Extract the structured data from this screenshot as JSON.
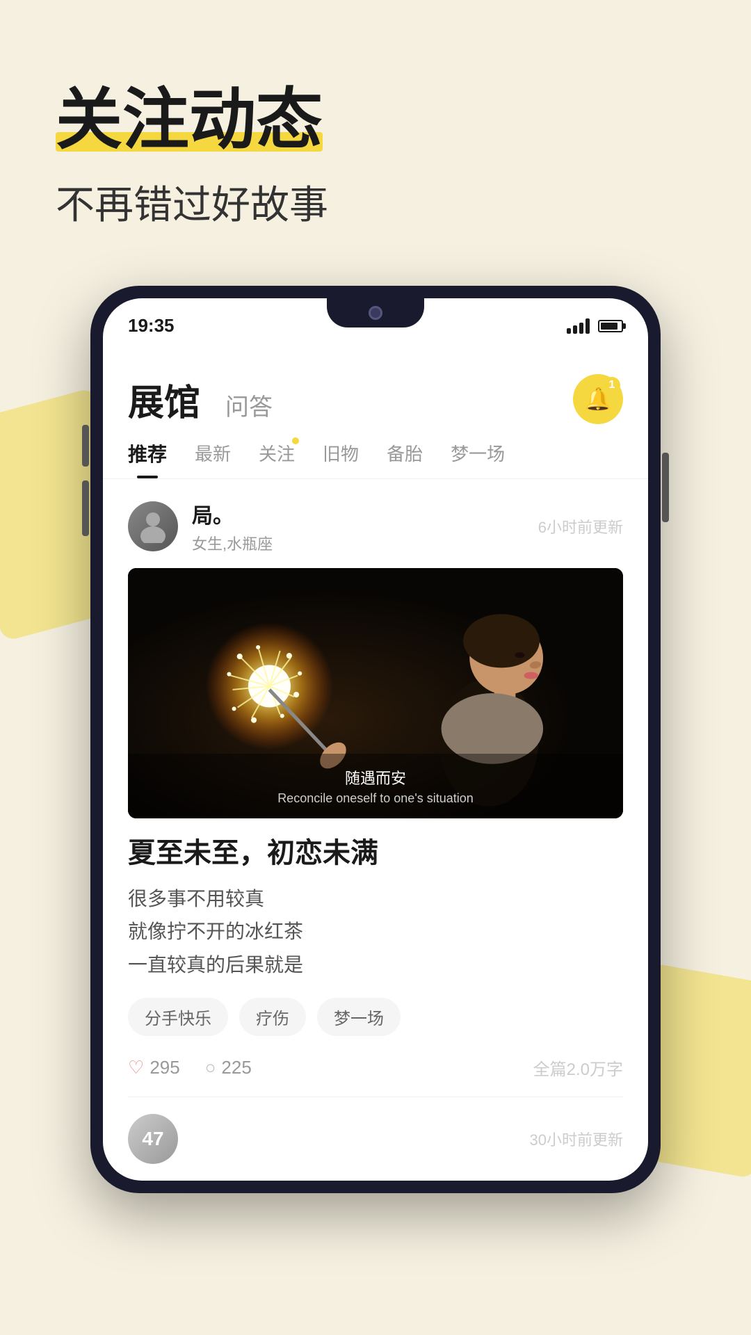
{
  "page": {
    "background_color": "#f5f0e0",
    "accent_color": "#f5d840"
  },
  "header": {
    "title": "关注动态",
    "subtitle": "不再错过好故事"
  },
  "phone": {
    "status_bar": {
      "time": "19:35",
      "signal": "signal",
      "battery": "battery"
    },
    "app": {
      "nav": {
        "main_label": "展馆",
        "sub_label": "问答",
        "notification_count": "1"
      },
      "tabs": [
        {
          "label": "推荐",
          "active": true,
          "has_dot": false
        },
        {
          "label": "最新",
          "active": false,
          "has_dot": false
        },
        {
          "label": "关注",
          "active": false,
          "has_dot": true
        },
        {
          "label": "旧物",
          "active": false,
          "has_dot": false
        },
        {
          "label": "备胎",
          "active": false,
          "has_dot": false
        },
        {
          "label": "梦一场",
          "active": false,
          "has_dot": false
        }
      ],
      "posts": [
        {
          "author_name": "局。",
          "author_meta": "女生,水瓶座",
          "time_ago": "6小时前更新",
          "image_caption_cn": "随遇而安",
          "image_caption_en": "Reconcile oneself to one's situation",
          "title": "夏至未至，初恋未满",
          "excerpt_lines": [
            "很多事不用较真",
            "就像拧不开的冰红茶",
            "一直较真的后果就是"
          ],
          "tags": [
            "分手快乐",
            "疗伤",
            "梦一场"
          ],
          "likes": "295",
          "comments": "225",
          "word_count": "全篇2.0万字"
        },
        {
          "author_name": "47",
          "time_ago": "30小时前更新"
        }
      ]
    }
  }
}
